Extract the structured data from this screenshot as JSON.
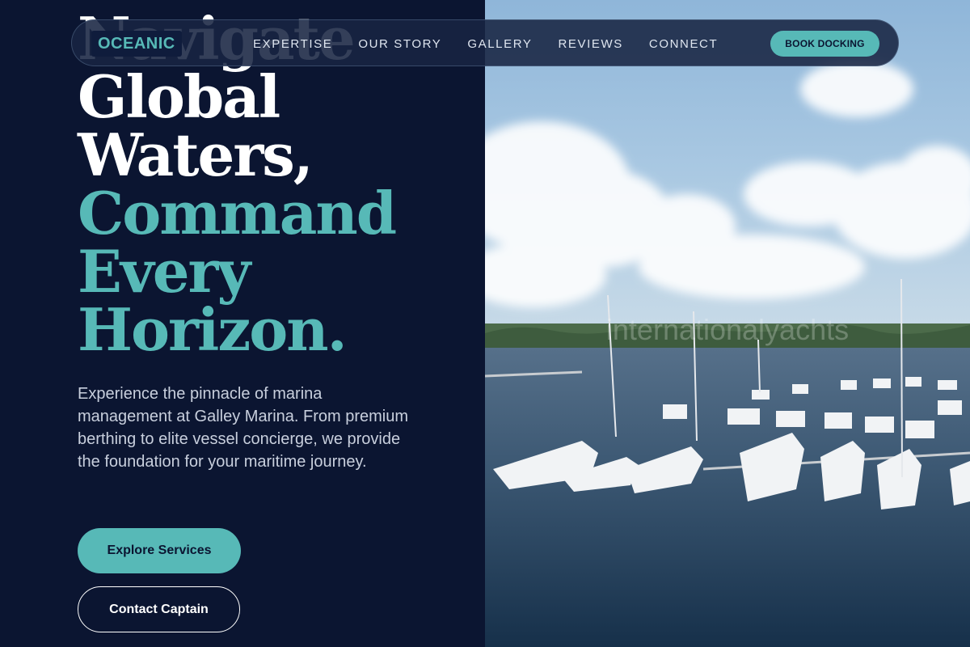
{
  "nav": {
    "logo": "OCEANIC",
    "items": [
      {
        "label": "EXPERTISE"
      },
      {
        "label": "OUR STORY"
      },
      {
        "label": "GALLERY"
      },
      {
        "label": "REVIEWS"
      },
      {
        "label": "CONNECT"
      }
    ],
    "cta": "BOOK DOCKING"
  },
  "hero": {
    "title_cut": "Navigate",
    "title_lines": [
      "Global",
      "Waters,"
    ],
    "title_accent_lines": [
      "Command",
      "Every",
      "Horizon."
    ],
    "description": "Experience the pinnacle of marina management at Galley Marina. From premium berthing to elite vessel concierge, we provide the foundation for your maritime journey.",
    "primary_button": "Explore Services",
    "secondary_button": "Contact Captain"
  },
  "image": {
    "watermark": "internationalyachts"
  },
  "colors": {
    "navy": "#0b1531",
    "teal": "#57b9b7",
    "white": "#ffffff"
  }
}
